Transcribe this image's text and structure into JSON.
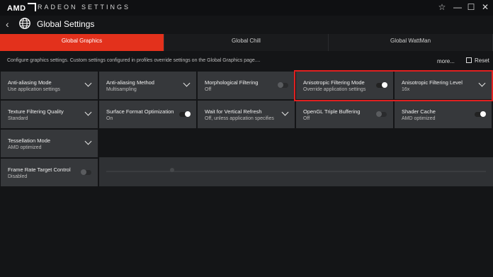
{
  "titlebar": {
    "brand": "AMD",
    "subtitle": "RADEON SETTINGS",
    "star_icon": "star-icon",
    "minimize_icon": "minimize-icon",
    "maximize_icon": "maximize-icon",
    "close_icon": "close-icon"
  },
  "header": {
    "back_icon": "back-arrow-icon",
    "globe_icon": "globe-icon",
    "title": "Global Settings"
  },
  "tabs": [
    {
      "label": "Global Graphics",
      "active": true
    },
    {
      "label": "Global Chill",
      "active": false
    },
    {
      "label": "Global WattMan",
      "active": false
    }
  ],
  "description": "Configure graphics settings. Custom settings configured in profiles override settings on the Global Graphics page....",
  "more_label": "more...",
  "reset_label": "Reset",
  "accent_color": "#e3311c",
  "highlight_color": "#e02020",
  "settings": [
    {
      "name": "Anti-aliasing Mode",
      "value": "Use application settings",
      "control": "dropdown"
    },
    {
      "name": "Anti-aliasing Method",
      "value": "Multisampling",
      "control": "dropdown"
    },
    {
      "name": "Morphological Filtering",
      "value": "Off",
      "control": "toggle-off"
    },
    {
      "name": "Anisotropic Filtering Mode",
      "value": "Override application settings",
      "control": "toggle-on"
    },
    {
      "name": "Anisotropic Filtering Level",
      "value": "16x",
      "control": "dropdown"
    },
    {
      "name": "Texture Filtering Quality",
      "value": "Standard",
      "control": "dropdown"
    },
    {
      "name": "Surface Format Optimization",
      "value": "On",
      "control": "toggle-on"
    },
    {
      "name": "Wait for Vertical Refresh",
      "value": "Off, unless application specifies",
      "control": "dropdown"
    },
    {
      "name": "OpenGL Triple Buffering",
      "value": "Off",
      "control": "toggle-off"
    },
    {
      "name": "Shader Cache",
      "value": "AMD optimized",
      "control": "toggle-on"
    },
    {
      "name": "Tessellation Mode",
      "value": "AMD optimized",
      "control": "dropdown"
    },
    {
      "name": "Frame Rate Target Control",
      "value": "Disabled",
      "control": "toggle-off"
    }
  ]
}
